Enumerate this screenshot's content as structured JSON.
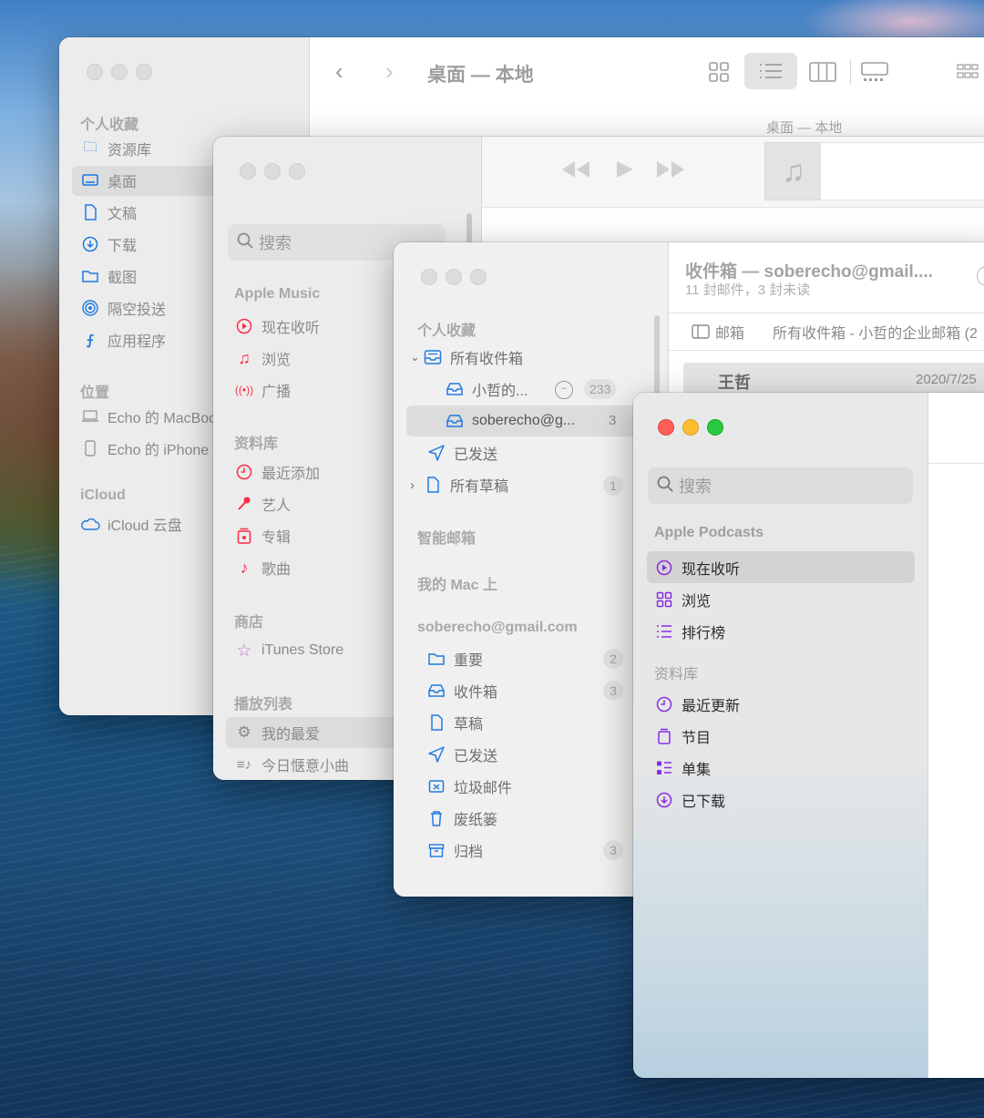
{
  "finder": {
    "title": "桌面 — 本地",
    "path_label": "桌面 — 本地",
    "sections": {
      "favorites": "个人收藏",
      "locations": "位置",
      "icloud": "iCloud"
    },
    "favorites": [
      {
        "label": "资源库",
        "icon": "folder-icon"
      },
      {
        "label": "桌面",
        "icon": "desktop-icon"
      },
      {
        "label": "文稿",
        "icon": "document-icon"
      },
      {
        "label": "下载",
        "icon": "download-icon"
      },
      {
        "label": "截图",
        "icon": "folder-icon"
      },
      {
        "label": "隔空投送",
        "icon": "airdrop-icon"
      },
      {
        "label": "应用程序",
        "icon": "apps-icon"
      }
    ],
    "locations": [
      {
        "label": "Echo 的 MacBoo",
        "icon": "laptop-icon"
      },
      {
        "label": "Echo 的 iPhone",
        "icon": "phone-icon"
      }
    ],
    "icloud_items": [
      {
        "label": "iCloud 云盘",
        "icon": "cloud-icon"
      }
    ]
  },
  "music": {
    "search_placeholder": "搜索",
    "sections": {
      "apple_music": "Apple Music",
      "library": "资料库",
      "store": "商店",
      "playlists": "播放列表"
    },
    "apple_music": [
      {
        "label": "现在收听",
        "icon": "play-circle-icon"
      },
      {
        "label": "浏览",
        "icon": "music-note-icon"
      },
      {
        "label": "广播",
        "icon": "radio-icon"
      }
    ],
    "library": [
      {
        "label": "最近添加",
        "icon": "clock-icon"
      },
      {
        "label": "艺人",
        "icon": "microphone-icon"
      },
      {
        "label": "专辑",
        "icon": "album-icon"
      },
      {
        "label": "歌曲",
        "icon": "music-note-icon"
      }
    ],
    "store": [
      {
        "label": "iTunes Store",
        "icon": "star-icon"
      }
    ],
    "playlists": [
      {
        "label": "我的最爱",
        "icon": "gear-icon"
      },
      {
        "label": "今日惬意小曲",
        "icon": "playlist-icon"
      }
    ]
  },
  "mail": {
    "header_title": "收件箱 — soberecho@gmail....",
    "header_subtitle": "11 封邮件，3 封未读",
    "toolbar_mailbox": "邮箱",
    "toolbar_breadcrumb": "所有收件箱 - 小哲的企业邮箱 (2",
    "message_sender": "王哲",
    "message_date": "2020/7/25",
    "sections": {
      "favorites": "个人收藏",
      "smart": "智能邮箱",
      "on_my_mac": "我的 Mac 上",
      "account": "soberecho@gmail.com"
    },
    "favorites": [
      {
        "label": "所有收件箱",
        "icon": "inbox-icon"
      },
      {
        "label": "小哲的...",
        "icon": "inbox-icon",
        "badge": "233"
      },
      {
        "label": "soberecho@g...",
        "icon": "inbox-icon",
        "badge": "3"
      },
      {
        "label": "已发送",
        "icon": "send-icon"
      },
      {
        "label": "所有草稿",
        "icon": "document-icon",
        "badge": "1"
      }
    ],
    "account_items": [
      {
        "label": "重要",
        "icon": "folder-icon",
        "badge": "2"
      },
      {
        "label": "收件箱",
        "icon": "inbox-icon",
        "badge": "3"
      },
      {
        "label": "草稿",
        "icon": "document-icon"
      },
      {
        "label": "已发送",
        "icon": "send-icon"
      },
      {
        "label": "垃圾邮件",
        "icon": "junk-icon"
      },
      {
        "label": "废纸篓",
        "icon": "trash-icon"
      },
      {
        "label": "归档",
        "icon": "archive-icon",
        "badge": "3"
      }
    ]
  },
  "podcasts": {
    "search_placeholder": "搜索",
    "sections": {
      "apple_podcasts": "Apple Podcasts",
      "library": "资料库"
    },
    "apple_podcasts": [
      {
        "label": "现在收听",
        "icon": "play-circle-icon"
      },
      {
        "label": "浏览",
        "icon": "grid-icon"
      },
      {
        "label": "排行榜",
        "icon": "list-icon"
      }
    ],
    "library": [
      {
        "label": "最近更新",
        "icon": "clock-icon"
      },
      {
        "label": "节目",
        "icon": "shows-icon"
      },
      {
        "label": "单集",
        "icon": "episodes-icon"
      },
      {
        "label": "已下载",
        "icon": "download-icon"
      }
    ]
  },
  "colors": {
    "finder_accent": "#1f7ae0",
    "music_accent": "#fa2d48",
    "mail_accent": "#1f7ae0",
    "podcasts_accent": "#8a2be2"
  }
}
